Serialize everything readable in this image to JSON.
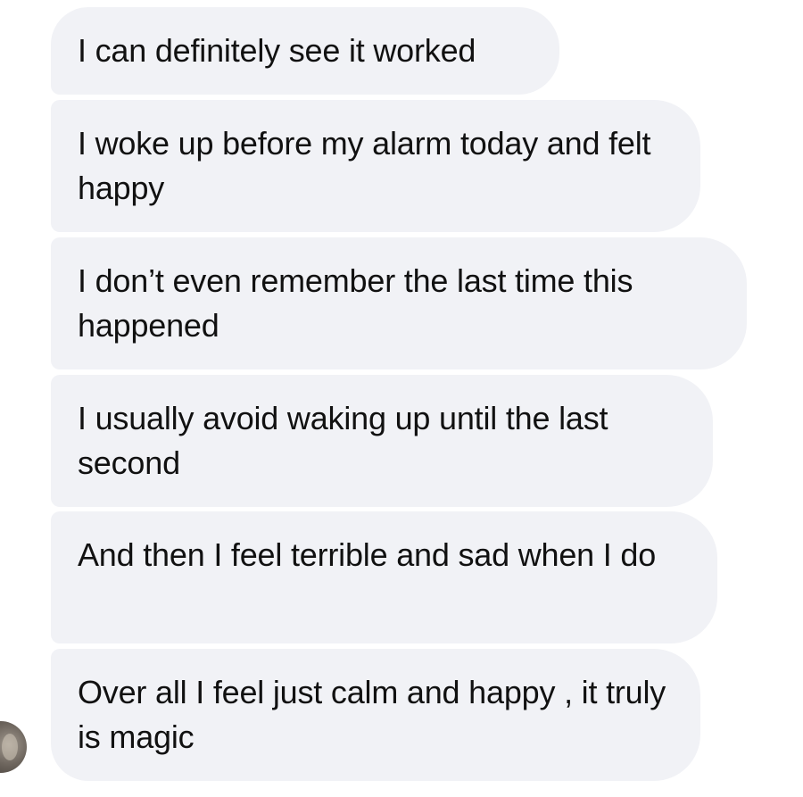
{
  "conversation": {
    "messages": [
      {
        "text": "I can definitely see it worked"
      },
      {
        "text": "I woke up before my alarm today and felt happy"
      },
      {
        "text": "I don’t even remember the last time this happened"
      },
      {
        "text": "I usually avoid waking up until the last second"
      },
      {
        "text": "And then I feel terrible and sad when I do"
      },
      {
        "text": "Over all I feel just calm and happy , it truly is magic"
      }
    ]
  },
  "colors": {
    "bubble_background": "#f1f2f6",
    "message_text": "#111111",
    "page_background": "#ffffff"
  },
  "icons": {
    "sender_avatar": "avatar-photo"
  }
}
